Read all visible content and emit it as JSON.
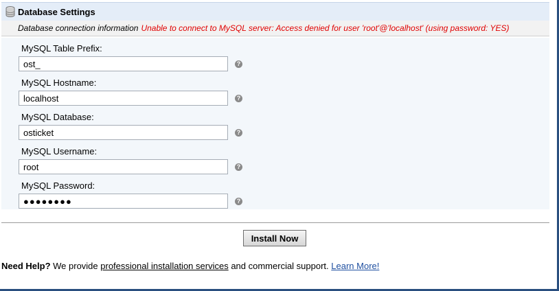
{
  "section": {
    "title": "Database Settings",
    "info_label": "Database connection information",
    "error_message": "Unable to connect to MySQL server: Access denied for user 'root'@'localhost' (using password: YES)"
  },
  "fields": [
    {
      "label": "MySQL Table Prefix:",
      "value": "ost_"
    },
    {
      "label": "MySQL Hostname:",
      "value": "localhost"
    },
    {
      "label": "MySQL Database:",
      "value": "osticket"
    },
    {
      "label": "MySQL Username:",
      "value": "root"
    },
    {
      "label": "MySQL Password:",
      "value": "●●●●●●●●"
    }
  ],
  "help_icon_glyph": "?",
  "install_button": "Install Now",
  "help": {
    "lead": "Need Help?",
    "text_before": " We provide ",
    "services_link": "professional installation services",
    "text_after": " and commercial support. ",
    "learn_more": "Learn More!"
  },
  "colors": {
    "error": "#e00000",
    "link": "#1f4fa0",
    "header_bg": "#e4edf8",
    "frame": "#2a4f7f"
  }
}
